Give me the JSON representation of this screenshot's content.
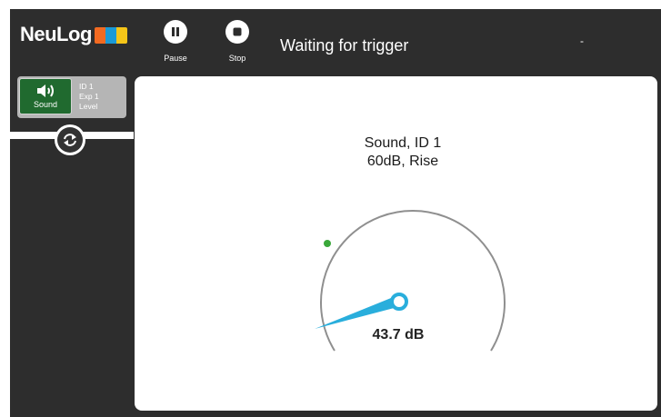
{
  "app": {
    "logo_text": "NeuLog"
  },
  "toolbar": {
    "pause_label": "Pause",
    "stop_label": "Stop",
    "status_text": "Waiting for trigger",
    "status_extra": "-"
  },
  "sensor": {
    "name": "Sound",
    "info_line1": "ID 1",
    "info_line2": "Exp 1",
    "info_line3": "Level",
    "icon": "speaker-icon"
  },
  "meter": {
    "title_line1": "Sound, ID 1",
    "title_line2": "60dB, Rise",
    "reading": "43.7 dB"
  },
  "colors": {
    "frame": "#2d2d2d",
    "sensor_green": "#206a2f",
    "needle": "#29aedc",
    "trigger_dot": "#3aa83a",
    "logo_orange": "#f26a21",
    "logo_blue": "#1b9ad6",
    "logo_yellow": "#f5c518"
  }
}
